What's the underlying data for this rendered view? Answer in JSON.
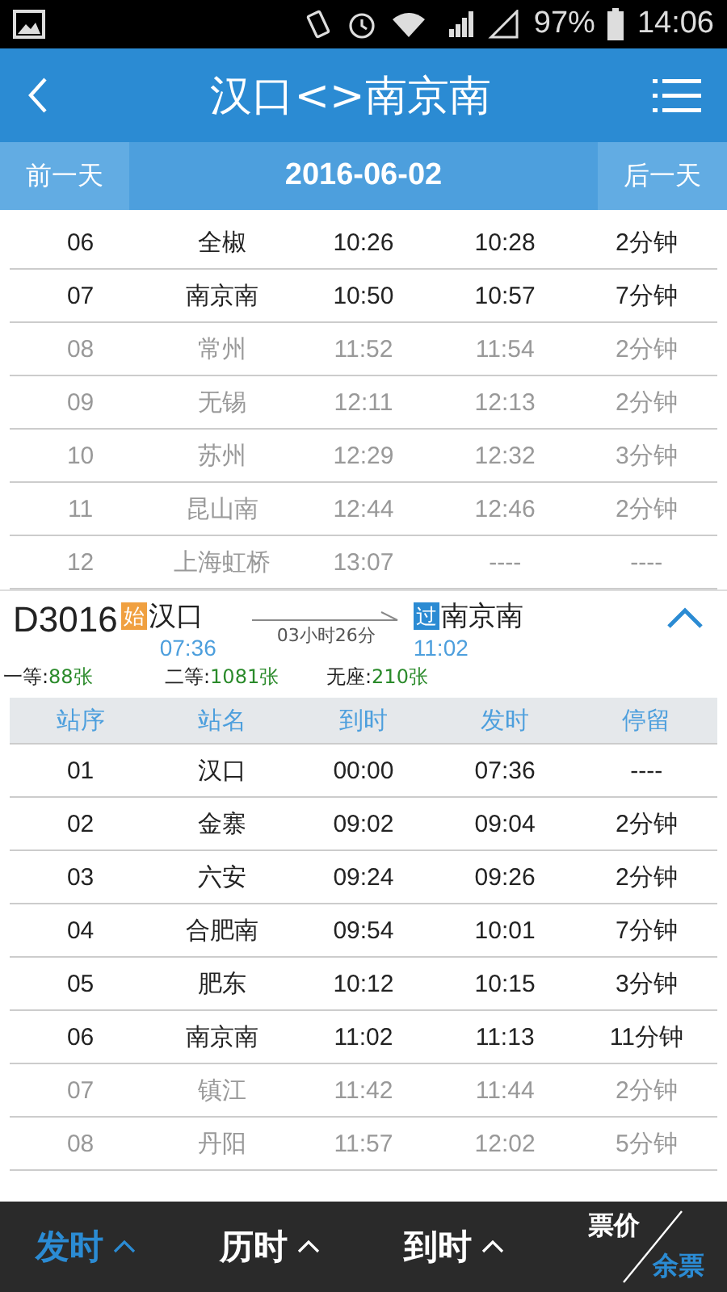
{
  "status_bar": {
    "battery": "97%",
    "time": "14:06"
  },
  "header": {
    "title": "汉口<>南京南"
  },
  "date_bar": {
    "prev": "前一天",
    "date": "2016-06-02",
    "next": "后一天"
  },
  "upper_stops": [
    {
      "no": "06",
      "station": "全椒",
      "arrive": "10:26",
      "depart": "10:28",
      "stay": "2分钟",
      "in_route": true
    },
    {
      "no": "07",
      "station": "南京南",
      "arrive": "10:50",
      "depart": "10:57",
      "stay": "7分钟",
      "in_route": true
    },
    {
      "no": "08",
      "station": "常州",
      "arrive": "11:52",
      "depart": "11:54",
      "stay": "2分钟",
      "in_route": false
    },
    {
      "no": "09",
      "station": "无锡",
      "arrive": "12:11",
      "depart": "12:13",
      "stay": "2分钟",
      "in_route": false
    },
    {
      "no": "10",
      "station": "苏州",
      "arrive": "12:29",
      "depart": "12:32",
      "stay": "3分钟",
      "in_route": false
    },
    {
      "no": "11",
      "station": "昆山南",
      "arrive": "12:44",
      "depart": "12:46",
      "stay": "2分钟",
      "in_route": false
    },
    {
      "no": "12",
      "station": "上海虹桥",
      "arrive": "13:07",
      "depart": "----",
      "stay": "----",
      "in_route": false
    }
  ],
  "train": {
    "number": "D3016",
    "expanded": true,
    "from": {
      "badge": "始",
      "kind": "start",
      "station": "汉口",
      "time": "07:36"
    },
    "duration": "03小时26分",
    "to": {
      "badge": "过",
      "kind": "pass",
      "station": "南京南",
      "time": "11:02"
    },
    "seats": [
      {
        "label": "一等:",
        "count": "88张"
      },
      {
        "label": "二等:",
        "count": "1081张"
      },
      {
        "label": "无座:",
        "count": "210张"
      }
    ]
  },
  "columns": [
    "站序",
    "站名",
    "到时",
    "发时",
    "停留"
  ],
  "stops": [
    {
      "no": "01",
      "station": "汉口",
      "arrive": "00:00",
      "depart": "07:36",
      "stay": "----",
      "in_route": true
    },
    {
      "no": "02",
      "station": "金寨",
      "arrive": "09:02",
      "depart": "09:04",
      "stay": "2分钟",
      "in_route": true
    },
    {
      "no": "03",
      "station": "六安",
      "arrive": "09:24",
      "depart": "09:26",
      "stay": "2分钟",
      "in_route": true
    },
    {
      "no": "04",
      "station": "合肥南",
      "arrive": "09:54",
      "depart": "10:01",
      "stay": "7分钟",
      "in_route": true
    },
    {
      "no": "05",
      "station": "肥东",
      "arrive": "10:12",
      "depart": "10:15",
      "stay": "3分钟",
      "in_route": true
    },
    {
      "no": "06",
      "station": "南京南",
      "arrive": "11:02",
      "depart": "11:13",
      "stay": "11分钟",
      "in_route": true
    },
    {
      "no": "07",
      "station": "镇江",
      "arrive": "11:42",
      "depart": "11:44",
      "stay": "2分钟",
      "in_route": false
    },
    {
      "no": "08",
      "station": "丹阳",
      "arrive": "11:57",
      "depart": "12:02",
      "stay": "5分钟",
      "in_route": false
    }
  ],
  "sort_options": [
    {
      "label": "发时",
      "selected": true
    },
    {
      "label": "历时",
      "selected": false
    },
    {
      "label": "到时",
      "selected": false
    }
  ],
  "price_toggle": [
    {
      "label": "票价",
      "selected": false
    },
    {
      "label": "余票",
      "selected": true
    }
  ]
}
